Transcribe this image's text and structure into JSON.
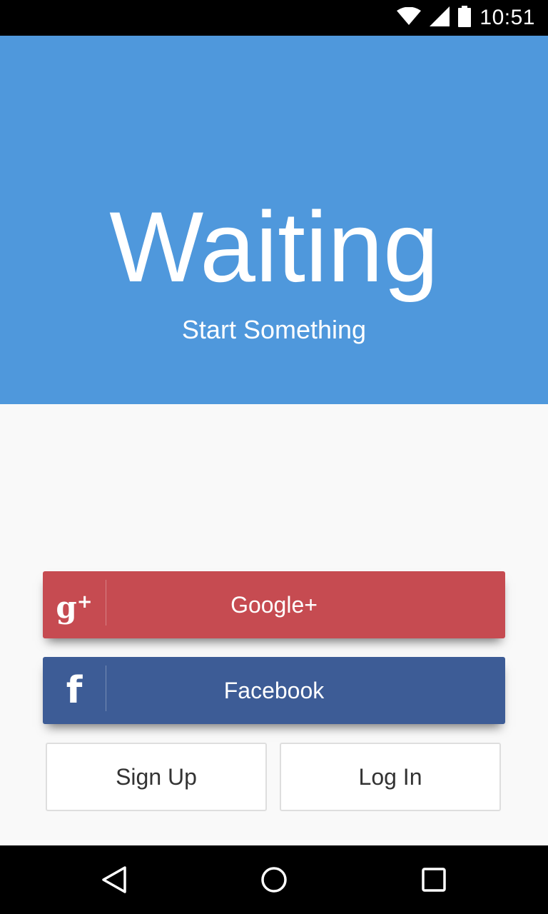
{
  "status_bar": {
    "time": "10:51",
    "icons": [
      "wifi-icon",
      "cell-signal-icon",
      "battery-icon"
    ]
  },
  "hero": {
    "title": "Waiting",
    "subtitle": "Start Something",
    "background_color": "#4f98dc"
  },
  "social_buttons": {
    "google": {
      "label": "Google+",
      "icon": "google-plus-icon",
      "color": "#c64b51"
    },
    "facebook": {
      "label": "Facebook",
      "icon": "facebook-icon",
      "color": "#3d5c96"
    }
  },
  "auth_buttons": {
    "signup_label": "Sign Up",
    "login_label": "Log In"
  },
  "nav_bar": {
    "buttons": [
      "back-icon",
      "home-icon",
      "recents-icon"
    ]
  }
}
